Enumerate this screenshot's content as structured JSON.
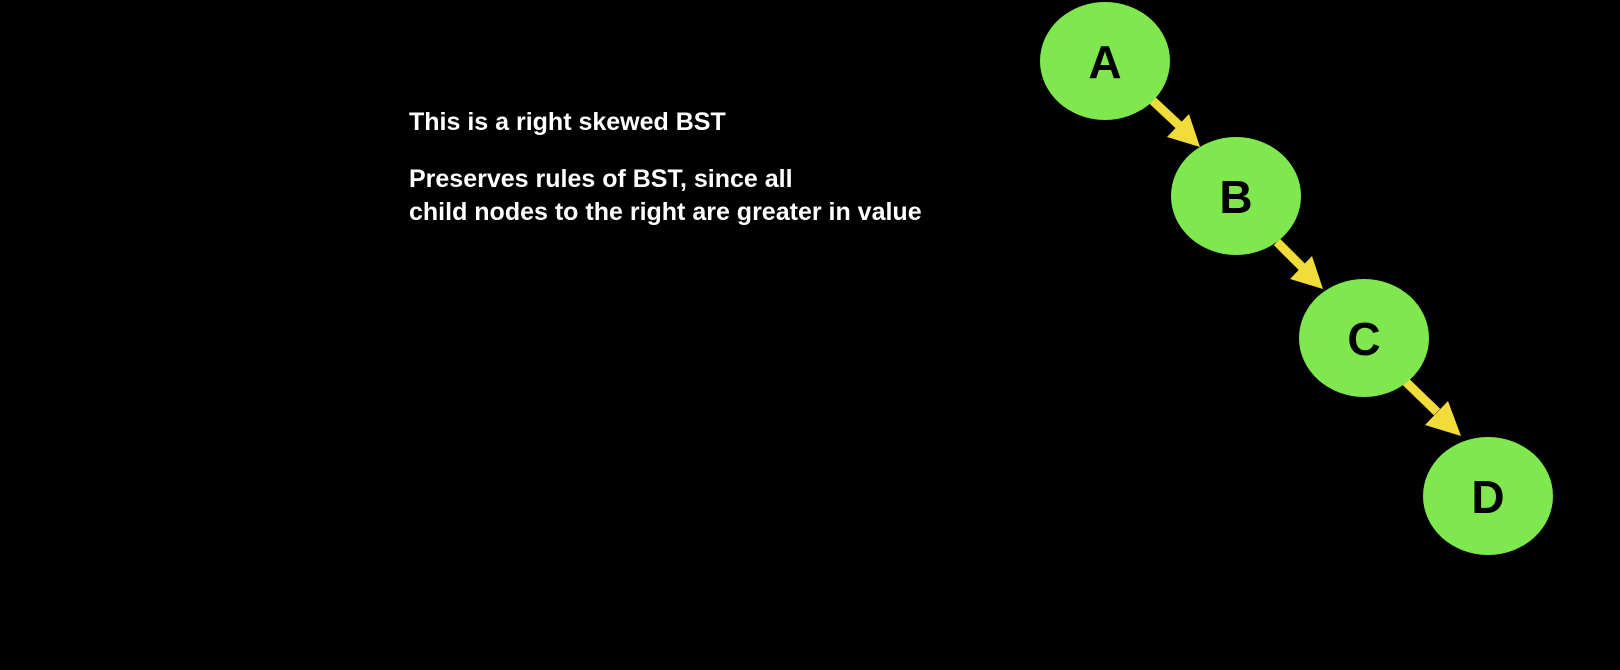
{
  "text": {
    "heading": "This is a right skewed BST",
    "line1": "Preserves rules of BST, since all",
    "line2": "child nodes to the right are greater in value"
  },
  "tree": {
    "nodes": [
      {
        "id": "A",
        "label": "A"
      },
      {
        "id": "B",
        "label": "B"
      },
      {
        "id": "C",
        "label": "C"
      },
      {
        "id": "D",
        "label": "D"
      }
    ],
    "edges": [
      {
        "from": "A",
        "to": "B"
      },
      {
        "from": "B",
        "to": "C"
      },
      {
        "from": "C",
        "to": "D"
      }
    ]
  },
  "colors": {
    "background": "#000000",
    "node_fill": "#7ee84e",
    "edge": "#f2dc3c",
    "text": "#ffffff",
    "node_text": "#000000"
  }
}
